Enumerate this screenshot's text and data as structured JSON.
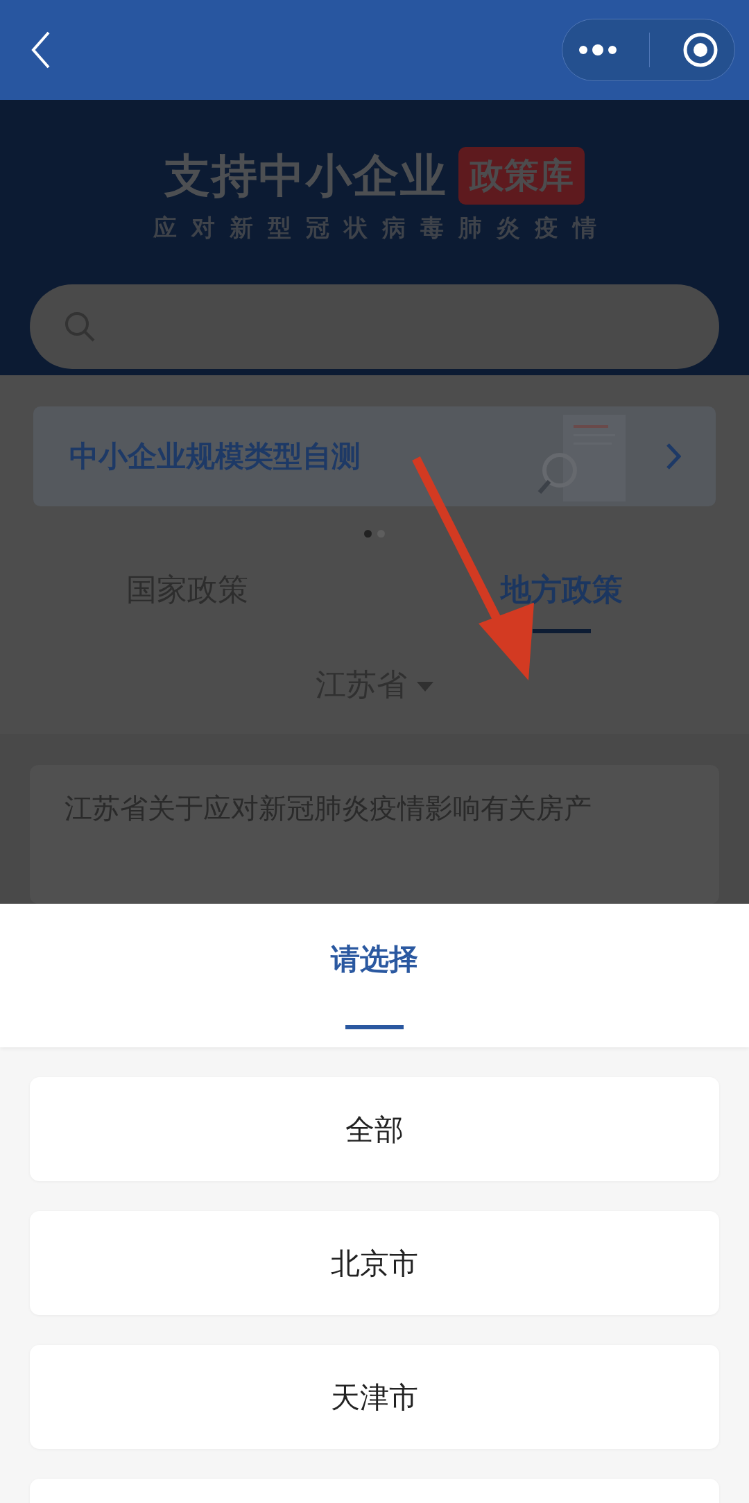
{
  "header": {
    "title": "支持中小企业",
    "badge": "政策库",
    "subtitle": "应对新型冠状病毒肺炎疫情"
  },
  "banner": {
    "title": "中小企业规模类型自测",
    "pages": [
      {
        "selected": true
      },
      {
        "selected": false
      }
    ]
  },
  "tabs": [
    {
      "label": "国家政策",
      "selected": false
    },
    {
      "label": "地方政策",
      "selected": true
    }
  ],
  "region_filter": {
    "value": "江苏省"
  },
  "policies": [
    {
      "title": "江苏省关于应对新冠肺炎疫情影响有关房产"
    }
  ],
  "picker": {
    "title": "请选择",
    "options": [
      {
        "label": "全部"
      },
      {
        "label": "北京市"
      },
      {
        "label": "天津市"
      }
    ]
  }
}
